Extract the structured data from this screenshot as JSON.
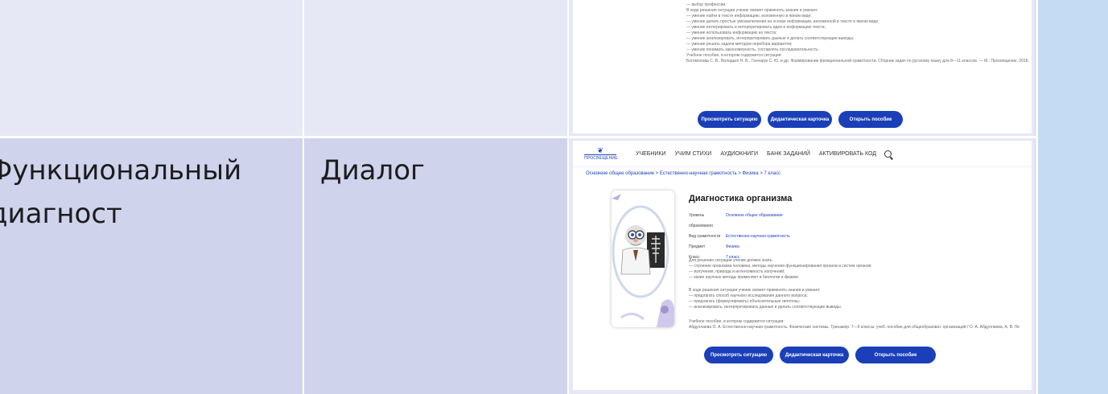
{
  "table": {
    "row2_col1": "Функциональный диагност",
    "row2_col2": "Диалог"
  },
  "top_screenshot": {
    "lines": [
      "— выбор профессии.",
      "",
      "В ходе решения ситуации ученик сможет применять знания и умения:",
      "— умение найти в тексте информацию, изложенную в явном виде;",
      "— умение делать простые умозаключения на основе информации, изложенной в тексте в явном виде;",
      "— умение интегрировать и интерпретировать идеи и информацию текста;",
      "— умение использовать информацию из текста;",
      "— умение анализировать, интерпретировать данные и делать соответствующие выводы;",
      "— умение решать задачи методом перебора вариантов;",
      "— умение понимать закономерность, составлять последовательность.",
      "",
      "Учебное пособие, в котором содержится ситуация:",
      "Богомолова С. В., Володько Н. В., Гончарук С. Ю. и др. Формирование функциональной грамотности. Сборник задач по русскому языку для 8—11 классов. — М.: Просвещение, 2018."
    ],
    "buttons": [
      "Просмотреть ситуацию",
      "Дидактическая карточка",
      "Открыть пособие"
    ]
  },
  "bottom_screenshot": {
    "logo_text": "ПРОСВЕЩЕНИЕ",
    "nav": [
      "УЧЕБНИКИ",
      "УЧИМ СТИХИ",
      "АУДИОКНИГИ",
      "БАНК ЗАДАНИЙ",
      "АКТИВИРОВАТЬ КОД"
    ],
    "breadcrumb": "Основное общее образование > Естественно-научная грамотность > Физика > 7 класс",
    "title": "Диагностика организма",
    "info": [
      {
        "key": "Уровень образования",
        "value": "Основное общее образование"
      },
      {
        "key": "Вид грамотности",
        "value": "Естественно-научная грамотность"
      },
      {
        "key": "Предмет",
        "value": "Физика"
      },
      {
        "key": "Класс",
        "value": "7 класс"
      }
    ],
    "block1": [
      "Для решения ситуации ученик должен знать:",
      "— строение организма человека, методы изучения функционирования органов и систем органов;",
      "— излучения, природа и интенсивность излучений;",
      "— какие научные методы применяют в биологии и физике."
    ],
    "block2": [
      "В ходе решения ситуации ученик сможет применять знания и умения:",
      "— предлагать способ научного исследования данного вопроса;",
      "— предлагать (формулировать) объяснительные гипотезы;",
      "— анализировать, интерпретировать данные и делать соответствующие выводы."
    ],
    "block3": [
      "Учебное пособие, в котором содержится ситуация:",
      "Абдуллаева О. А. Естественно-научная грамотность. Физические системы. Тренажёр. 7—9 классы: учеб. пособие для общеобразоват. организаций / О. А. Абдуллаева, А. В. Ля"
    ],
    "buttons": [
      "Просмотреть ситуацию",
      "Дидактическая карточка",
      "Открыть пособие"
    ]
  },
  "colors": {
    "accent": "#1a3fb8",
    "row1_bg": "#e6e8f5",
    "row2_bg": "#cfd3ec",
    "side_panel": "#c5dbf4"
  }
}
